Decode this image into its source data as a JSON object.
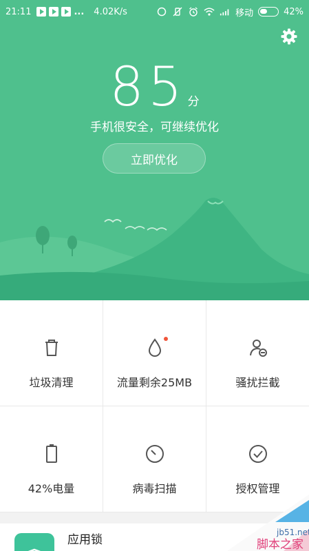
{
  "status_bar": {
    "time": "21:11",
    "dots": "...",
    "speed": "4.02K/s",
    "carrier": "移动",
    "battery": "42%",
    "battery_level": 0.42
  },
  "score": {
    "value": "85",
    "unit": "分",
    "message": "手机很安全，可继续优化"
  },
  "optimize_button": "立即优化",
  "tiles": [
    {
      "label": "垃圾清理",
      "icon": "trash-icon"
    },
    {
      "label": "流量剩余25MB",
      "icon": "data-drop-icon",
      "badge": true
    },
    {
      "label": "骚扰拦截",
      "icon": "block-user-icon"
    },
    {
      "label": "42%电量",
      "icon": "battery-icon"
    },
    {
      "label": "病毒扫描",
      "icon": "virus-scan-icon"
    },
    {
      "label": "授权管理",
      "icon": "permission-check-icon"
    }
  ],
  "app_lock": {
    "label": "应用锁",
    "icon": "shield-lock-icon"
  },
  "watermark": {
    "site": "jb51.net",
    "name": "脚本之家"
  },
  "colors": {
    "accent": "#4fc08d",
    "accent_dark": "#35a77a",
    "badge": "#f0553a"
  }
}
